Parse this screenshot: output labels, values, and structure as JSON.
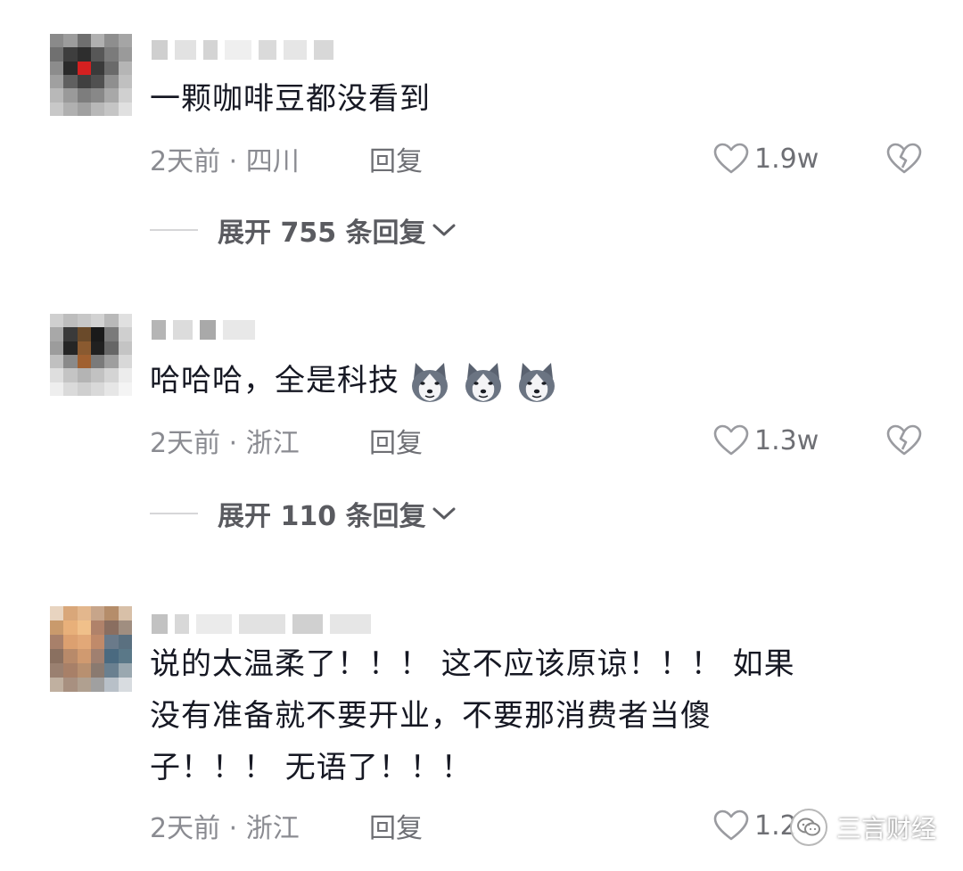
{
  "comments": [
    {
      "text": "一颗咖啡豆都没看到",
      "time": "2天前 · 四川",
      "reply_label": "回复",
      "likes": "1.9w",
      "expand_label": "展开 755 条回复"
    },
    {
      "text": "哈哈哈，全是科技",
      "emoji_count": 3,
      "emoji_icon": "husky-face-icon",
      "time": "2天前 · 浙江",
      "reply_label": "回复",
      "likes": "1.3w",
      "expand_label": "展开 110 条回复"
    },
    {
      "text": "说的太温柔了！！！ 这不应该原谅！！！ 如果\n没有准备就不要开业，不要那消费者当傻\n子！！！ 无语了！！！",
      "time": "2天前 · 浙江",
      "reply_label": "回复",
      "likes": "1.2"
    }
  ],
  "watermark": {
    "text": "三言财经",
    "icon": "wechat-icon"
  },
  "colors": {
    "text_primary": "#161823",
    "text_secondary": "#8a8b91",
    "divider": "#d6d6d8"
  }
}
